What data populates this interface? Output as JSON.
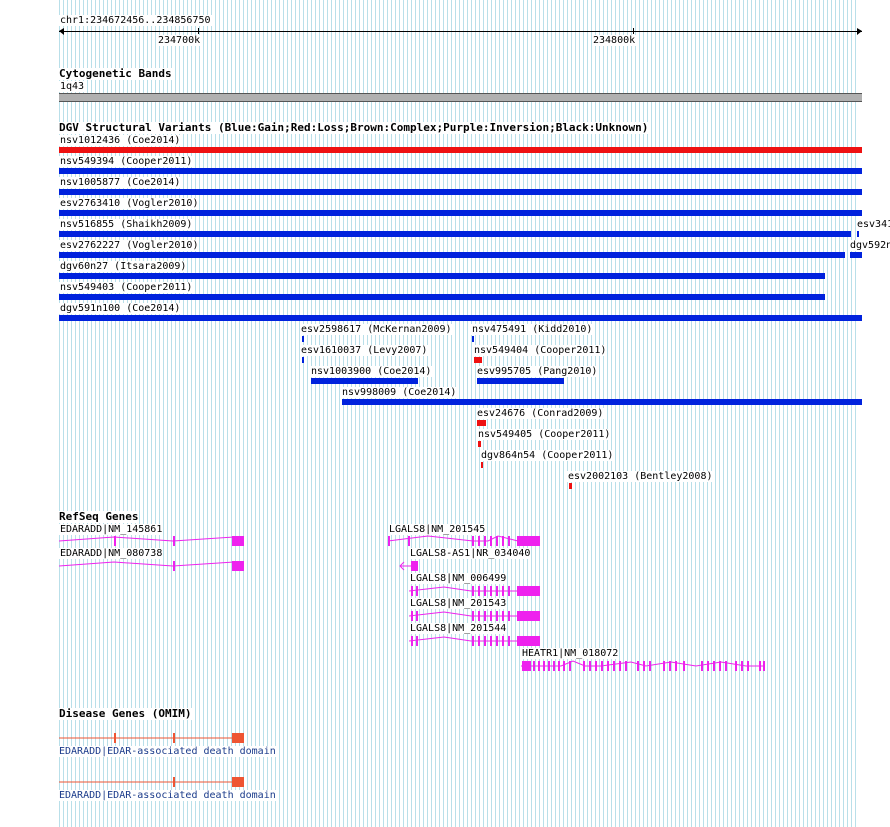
{
  "ruler": {
    "location": "chr1:234672456..234856750",
    "ticks": [
      "234700k",
      "234800k"
    ]
  },
  "tracks": {
    "cyto": {
      "title": "Cytogenetic Bands",
      "band": "1q43"
    },
    "dgv": {
      "title": "DGV Structural Variants (Blue:Gain;Red:Loss;Brown:Complex;Purple:Inversion;Black:Unknown)",
      "variants": [
        {
          "label": "nsv1012436 (Coe2014)",
          "color": "#ee1111"
        },
        {
          "label": "nsv549394 (Cooper2011)",
          "color": "#0022dd"
        },
        {
          "label": "nsv1005877 (Coe2014)",
          "color": "#0022dd"
        },
        {
          "label": "esv2763410 (Vogler2010)",
          "color": "#0022dd"
        },
        {
          "label": "nsv516855 (Shaikh2009)",
          "color": "#0022dd"
        },
        {
          "label": "esv2762227 (Vogler2010)",
          "color": "#0022dd"
        },
        {
          "label": "dgv60n27 (Itsara2009)",
          "color": "#0022dd"
        },
        {
          "label": "nsv549403 (Cooper2011)",
          "color": "#0022dd"
        },
        {
          "label": "dgv591n100 (Coe2014)",
          "color": "#0022dd"
        },
        {
          "label": "esv2598617 (McKernan2009)",
          "color": "#0022dd"
        },
        {
          "label": "nsv475491 (Kidd2010)",
          "color": "#0022dd"
        },
        {
          "label": "esv1610037 (Levy2007)",
          "color": "#0022dd"
        },
        {
          "label": "nsv549404 (Cooper2011)",
          "color": "#ee1111"
        },
        {
          "label": "nsv1003900 (Coe2014)",
          "color": "#0022dd"
        },
        {
          "label": "esv995705 (Pang2010)",
          "color": "#0022dd"
        },
        {
          "label": "nsv998009 (Coe2014)",
          "color": "#0022dd"
        },
        {
          "label": "esv24676 (Conrad2009)",
          "color": "#ee1111"
        },
        {
          "label": "nsv549405 (Cooper2011)",
          "color": "#ee1111"
        },
        {
          "label": "dgv864n54 (Cooper2011)",
          "color": "#ee1111"
        },
        {
          "label": "esv2002103 (Bentley2008)",
          "color": "#ee1111"
        }
      ],
      "edge_labels": [
        "esv341",
        "dgv592n"
      ]
    },
    "refseq": {
      "title": "RefSeq Genes",
      "color": "#ee22ee",
      "genes": [
        {
          "label": "EDARADD|NM_145861"
        },
        {
          "label": "EDARADD|NM_080738"
        },
        {
          "label": "LGALS8|NM_201545"
        },
        {
          "label": "LGALS8-AS1|NR_034040"
        },
        {
          "label": "LGALS8|NM_006499"
        },
        {
          "label": "LGALS8|NM_201543"
        },
        {
          "label": "LGALS8|NM_201544"
        },
        {
          "label": "HEATR1|NM_018072"
        }
      ]
    },
    "omim": {
      "title": "Disease Genes (OMIM)",
      "color": "#ee5533",
      "genes": [
        {
          "label": "EDARADD|EDAR-associated death domain"
        },
        {
          "label": "EDARADD|EDAR-associated death domain"
        }
      ]
    }
  }
}
